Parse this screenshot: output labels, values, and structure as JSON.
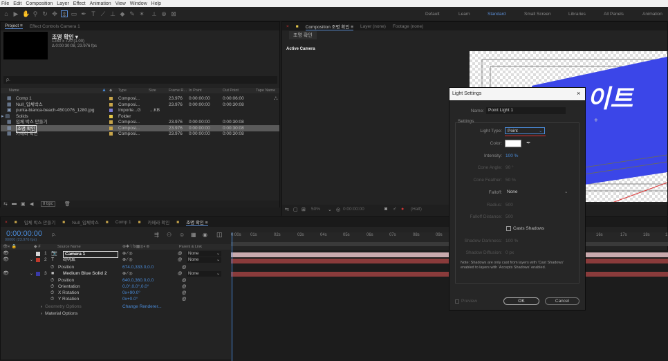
{
  "menu": [
    "File",
    "Edit",
    "Composition",
    "Layer",
    "Effect",
    "Animation",
    "View",
    "Window",
    "Help"
  ],
  "workspaces": {
    "items": [
      "Default",
      "Learn",
      "Standard",
      "Small Screen",
      "Libraries",
      "All Panels",
      "Animation"
    ],
    "active": "Standard"
  },
  "project": {
    "tabs": [
      "Project ≡",
      "Effect Controls Camera 1"
    ],
    "selected_name": "조명 확인 ▾",
    "selected_info1": "1280 x 720 (1.00)",
    "selected_info2": "Δ 0:00:30:08, 23.976 fps",
    "search_placeholder": "ρ.",
    "columns": [
      "Name",
      "Type",
      "Size",
      "Frame R...",
      "In Point",
      "Out Point",
      "Tape Name"
    ],
    "items": [
      {
        "name": "Comp 1",
        "type": "Composi...",
        "size": "",
        "fps": "23.976",
        "in": "0:00:00:00",
        "out": "0:00:06:00",
        "color": "#c8a54a"
      },
      {
        "name": "Null_입체박스",
        "type": "Composi...",
        "size": "",
        "fps": "23.976",
        "in": "0:00:00:00",
        "out": "0:00:30:08",
        "color": "#c8a54a"
      },
      {
        "name": "punta-bianca-beach-4501076_1280.jpg",
        "type": "Importe...G",
        "size": "...KB",
        "fps": "",
        "in": "",
        "out": "",
        "color": "#7b7bd6"
      },
      {
        "name": "Solids",
        "type": "Folder",
        "size": "",
        "fps": "",
        "in": "",
        "out": "",
        "color": "#e6c84a"
      },
      {
        "name": "입체 박스 만들기",
        "type": "Composi...",
        "size": "",
        "fps": "23.976",
        "in": "0:00:00:00",
        "out": "0:00:30:08",
        "color": "#c8a54a"
      },
      {
        "name": "조명 확인",
        "type": "Composi...",
        "size": "",
        "fps": "23.976",
        "in": "0:00:00:00",
        "out": "0:00:30:08",
        "color": "#c8a54a"
      },
      {
        "name": "카메라 확인",
        "type": "Composi...",
        "size": "",
        "fps": "23.976",
        "in": "0:00:00:00",
        "out": "0:00:30:08",
        "color": "#c8a54a"
      }
    ],
    "bpc": "8 bpc"
  },
  "composition": {
    "tabs": [
      "Composition 조명 확인 ≡",
      "Layer (none)",
      "Footage (none)"
    ],
    "sub_tab": "조명 확인",
    "view_label": "Active Camera",
    "big_text": "이트",
    "zoom": "50%",
    "timecode": "0:00:00:00",
    "res": "(Half)"
  },
  "timeline": {
    "tabs": [
      "입체 박스 만들기",
      "Null_입체박스",
      "Comp 1",
      "카메라 확인",
      "조명 확인 ≡"
    ],
    "timecode": "0:00:00:00",
    "fps_label": "00000 (23.976 fps)",
    "search_placeholder": "ρ.",
    "col_source": "Source Name",
    "col_parent": "Parent & Link",
    "ruler": [
      "0:00s",
      "01s",
      "02s",
      "03s",
      "04s",
      "05s",
      "06s",
      "07s",
      "08s",
      "09s",
      "16s",
      "17s",
      "18s",
      "1"
    ],
    "rows": [
      {
        "num": "1",
        "name": "Camera 1",
        "parent": "None",
        "color": "#d4d4d4"
      },
      {
        "num": "2",
        "name": "라이트",
        "parent": "None",
        "color": "#c0392b"
      },
      {
        "prop": "Position",
        "value": "674.0,333.0,0.0"
      },
      {
        "num": "3",
        "name": "Medium Blue Solid 2",
        "parent": "None",
        "color": "#3a3aa8"
      },
      {
        "prop": "Position",
        "value": "640.0,360.0,0.0"
      },
      {
        "prop": "Orientation",
        "value": "0.0°,0.0°,0.0°"
      },
      {
        "prop": "X Rotation",
        "value": "0x+90.0°"
      },
      {
        "prop": "Y Rotation",
        "value": "0x+0.0°"
      },
      {
        "prop": "Geometry Options",
        "value": "Change Renderer..."
      },
      {
        "prop": "Material Options",
        "value": ""
      }
    ]
  },
  "dialog": {
    "title": "Light Settings",
    "name_label": "Name:",
    "name_value": "Point Light 1",
    "group_label": "Settings",
    "light_type_label": "Light Type:",
    "light_type_value": "Point",
    "color_label": "Color:",
    "color_value": "#ffffff",
    "intensity_label": "Intensity:",
    "intensity_value": "100 %",
    "cone_angle_label": "Cone Angle:",
    "cone_angle_value": "90 °",
    "cone_feather_label": "Cone Feather:",
    "cone_feather_value": "50 %",
    "falloff_label": "Falloff:",
    "falloff_value": "None",
    "radius_label": "Radius:",
    "radius_value": "500",
    "falloff_dist_label": "Falloff Distance:",
    "falloff_dist_value": "500",
    "casts_shadows_label": "Casts Shadows",
    "shadow_darkness_label": "Shadow Darkness:",
    "shadow_darkness_value": "100 %",
    "shadow_diffusion_label": "Shadow Diffusion:",
    "shadow_diffusion_value": "0 px",
    "note": "Note: Shadows are only cast from layers with 'Cast Shadows' enabled to layers with 'Accepts Shadows' enabled.",
    "preview_label": "Preview",
    "ok_label": "OK",
    "cancel_label": "Cancel"
  }
}
